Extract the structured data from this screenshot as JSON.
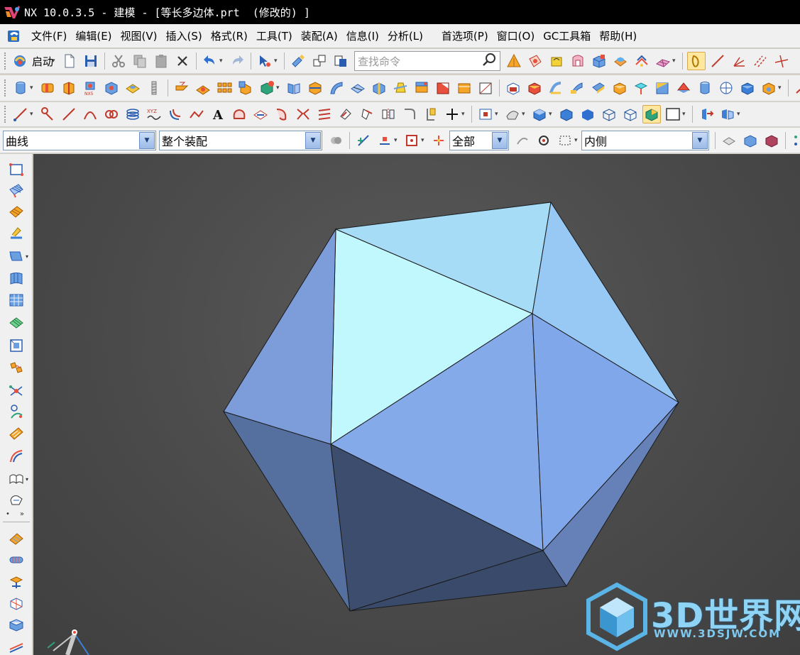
{
  "titlebar": {
    "title": "NX 10.0.3.5 - 建模 - [等长多边体.prt  (修改的) ]"
  },
  "menubar": {
    "items": [
      "文件(F)",
      "编辑(E)",
      "视图(V)",
      "插入(S)",
      "格式(R)",
      "工具(T)",
      "装配(A)",
      "信息(I)",
      "分析(L)",
      "首选项(P)",
      "窗口(O)",
      "GC工具箱",
      "帮助(H)"
    ]
  },
  "toolbar_standard": {
    "start_label": "启动",
    "search_placeholder": "查找命令"
  },
  "selection_bar": {
    "type_filter": "曲线",
    "scope_filter": "整个装配",
    "snap_filter": "全部",
    "location_filter": "内侧"
  },
  "colors": {
    "title_bg": "#000000",
    "toolbar_bg": "#f0f0f0",
    "viewport_bg": "#4a4a4a",
    "face_light": "#c0f8fd",
    "face_mid": "#85aaea",
    "face_dark": "#3d4d6d"
  },
  "watermark": {
    "brand": "3D世界网",
    "url": "WWW.3DSJW.COM"
  }
}
